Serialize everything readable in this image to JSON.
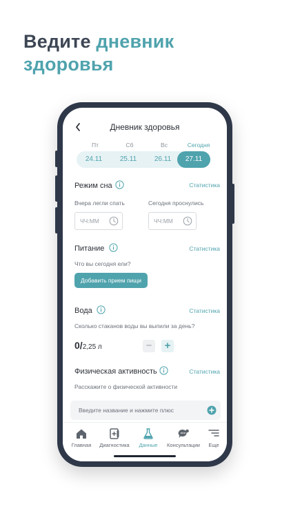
{
  "headline": {
    "part1": "Ведите",
    "accent": "дневник",
    "line2": "здоровья"
  },
  "screen": {
    "title": "Дневник здоровья",
    "days": [
      {
        "label": "Пт",
        "date": "24.11",
        "active": false
      },
      {
        "label": "Сб",
        "date": "25.11",
        "active": false
      },
      {
        "label": "Вс",
        "date": "26.11",
        "active": false
      },
      {
        "label": "Сегодня",
        "date": "27.11",
        "active": true
      }
    ],
    "sleep": {
      "title": "Режим сна",
      "stats": "Статистика",
      "bed_label": "Вчера легли спать",
      "wake_label": "Сегодня проснулись",
      "placeholder": "ЧЧ:ММ"
    },
    "food": {
      "title": "Питание",
      "stats": "Статистика",
      "hint": "Что вы сегодня ели?",
      "button": "Добавить прием пищи"
    },
    "water": {
      "title": "Вода",
      "stats": "Статистика",
      "hint": "Сколько стаканов воды вы выпили за день?",
      "amount": "0/",
      "goal": "2,25 л"
    },
    "activity": {
      "title": "Физическая активность",
      "stats": "Статистика",
      "hint": "Расскажите о физической активности",
      "placeholder": "Введите название и нажмите плюс"
    },
    "tabs": [
      {
        "label": "Главная",
        "icon": "home-icon"
      },
      {
        "label": "Диагностика",
        "icon": "diagnostics-icon"
      },
      {
        "label": "Данные",
        "icon": "flask-icon",
        "active": true
      },
      {
        "label": "Консультации",
        "icon": "chat-icon"
      },
      {
        "label": "Еще",
        "icon": "menu-icon"
      }
    ]
  },
  "colors": {
    "accent": "#4fa3ad",
    "dark_text": "#3d4654",
    "phone_frame": "#2e3849"
  }
}
